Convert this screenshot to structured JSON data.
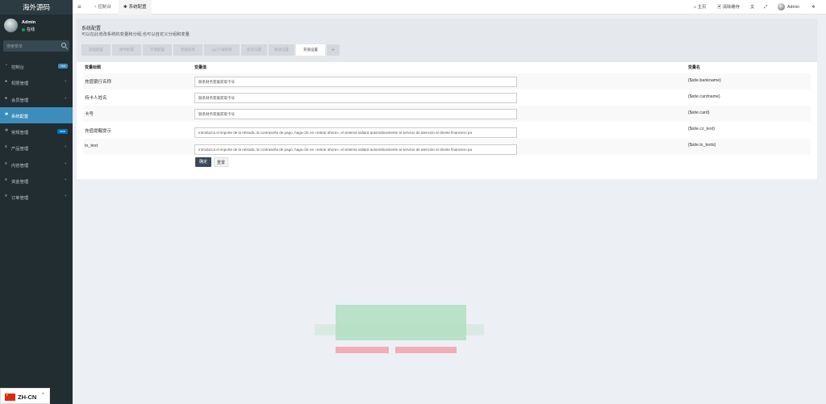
{
  "sidebar": {
    "brand": "海外源码",
    "user": {
      "name": "Admin",
      "status": "在线"
    },
    "search_placeholder": "搜索菜单",
    "items": [
      {
        "label": "控制台",
        "badge": "hot"
      },
      {
        "label": "权限管理"
      },
      {
        "label": "会员管理"
      },
      {
        "label": "系统配置"
      },
      {
        "label": "常规管理",
        "badge": "new"
      },
      {
        "label": "产品管理"
      },
      {
        "label": "内容管理"
      },
      {
        "label": "资金管理"
      },
      {
        "label": "订单管理"
      }
    ]
  },
  "language": {
    "code": "ZH-CN"
  },
  "topbar": {
    "tabs": [
      {
        "label": "控制台"
      },
      {
        "label": "系统配置"
      }
    ],
    "right": {
      "home": "主页",
      "clear_cache": "清除缓存",
      "user": "Admin"
    }
  },
  "page": {
    "title": "系统配置",
    "subtitle": "可以在此增改系统的变量和分组,也可以自定义分组和变量",
    "tabs": [
      "基础配置",
      "邮件配置",
      "字典配置",
      "客服链接",
      "app下载链接",
      "提现设置",
      "邀请设置",
      "充值设置",
      "+"
    ],
    "table_headers": {
      "title": "变量标题",
      "value": "变量值",
      "name": "变量名"
    },
    "rows": [
      {
        "title": "充值银行名称",
        "value": "联系财务客服获取卡号",
        "name": "{$site.bankname}"
      },
      {
        "title": "持卡人姓名",
        "value": "联系财务客服获取卡号",
        "name": "{$site.cardname}"
      },
      {
        "title": "卡号",
        "value": "联系财务客服获取卡号",
        "name": "{$site.card}"
      },
      {
        "title": "充值提醒提示",
        "value": "Introduzca el importe de la retirada, la contraseña de pago, haga clic en «retirar ahora», el sistema saltará automáticamente al servicio de atención al cliente financiero pa",
        "name": "{$site.cz_text}"
      },
      {
        "title": "tx_text",
        "value": "Introduzca el importe de la retirada, la contraseña de pago, haga clic en «retirar ahora», el sistema saltará automáticamente al servicio de atención al cliente financiero pa",
        "name": "{$site.tx_texts}"
      }
    ],
    "buttons": {
      "ok": "确定",
      "reset": "重置"
    }
  },
  "colors": {
    "sidebar": "#222d32",
    "active": "#3c8dbc",
    "content_bg": "#ecf0f5"
  }
}
